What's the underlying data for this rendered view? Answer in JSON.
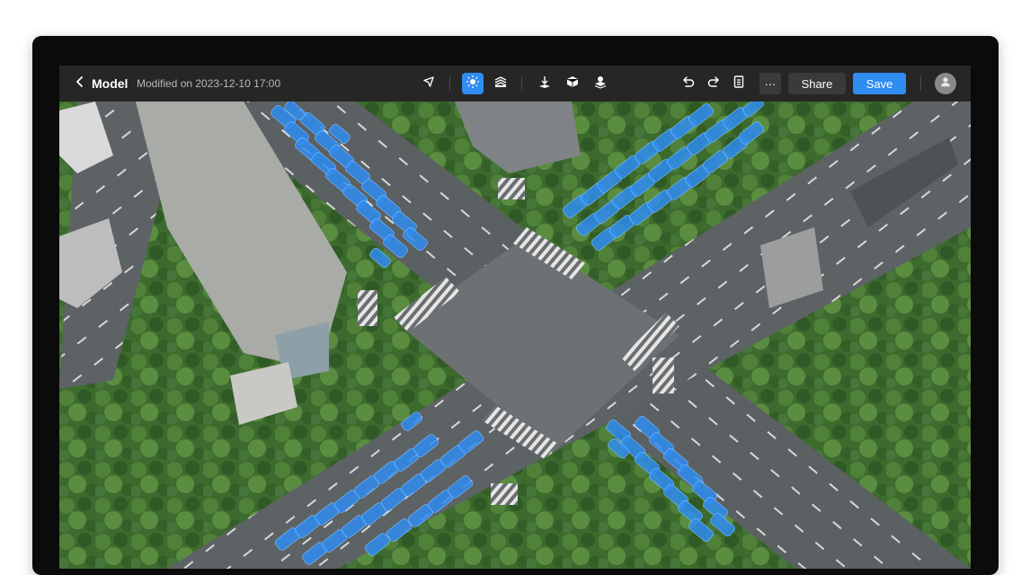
{
  "header": {
    "back_icon": "chevron-left-icon",
    "title": "Model",
    "modified": "Modified on 2023-12-10 17:00"
  },
  "toolbar": {
    "tools": [
      {
        "icon": "pointer-icon",
        "active": false
      },
      {
        "icon": "detect-icon",
        "active": true
      },
      {
        "icon": "layers-icon",
        "active": false
      },
      {
        "icon": "elevation-icon",
        "active": false
      },
      {
        "icon": "cube-icon",
        "active": false
      },
      {
        "icon": "stack-icon",
        "active": false
      }
    ],
    "undo_icon": "undo-icon",
    "redo_icon": "redo-icon",
    "notes_icon": "document-icon",
    "more_label": "···",
    "share_label": "Share",
    "save_label": "Save",
    "avatar_icon": "user-avatar-icon"
  },
  "colors": {
    "accent": "#2f8cf0",
    "toolbar_bg": "#262626",
    "detection": "#2f8cf0"
  }
}
